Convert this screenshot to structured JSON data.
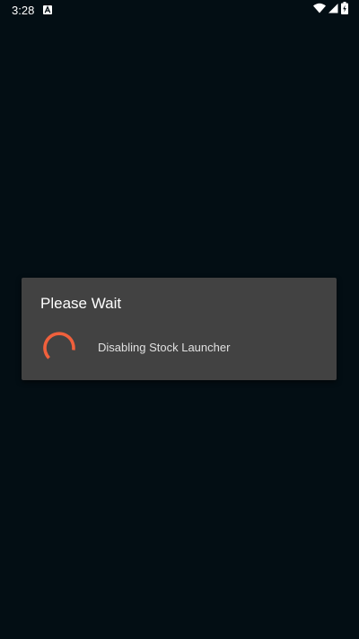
{
  "status_bar": {
    "time": "3:28",
    "notification_icon": "a-badge-icon",
    "wifi_icon": "wifi-icon",
    "signal_icon": "cell-signal-icon",
    "battery_icon": "battery-charging-icon"
  },
  "dialog": {
    "title": "Please Wait",
    "message": "Disabling Stock Launcher",
    "spinner_icon": "progress-spinner-icon"
  },
  "colors": {
    "background": "#030e14",
    "dialog_background": "#424242",
    "spinner_accent": "#f0603c",
    "text_primary": "#ffffff",
    "text_secondary": "#e0e0e0"
  }
}
